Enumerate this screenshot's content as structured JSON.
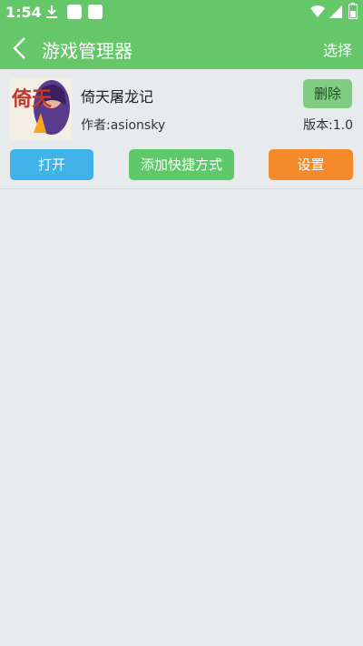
{
  "status_bar": {
    "time": "1:54",
    "icons": [
      "download-icon",
      "notification-square-icon",
      "notification-square-icon",
      "wifi-icon",
      "signal-icon",
      "battery-icon"
    ]
  },
  "app_bar": {
    "title": "游戏管理器",
    "select_label": "选择",
    "background_color": "#66c76a"
  },
  "game_card": {
    "name": "倚天屠龙记",
    "author": "作者:asionsky",
    "version": "版本:1.0",
    "icon_text": "倚天",
    "delete_label": "删除",
    "buttons": {
      "open": "打开",
      "add_shortcut": "添加快捷方式",
      "settings": "设置"
    },
    "colors": {
      "open": "#3fb2e8",
      "add_shortcut": "#5ec96a",
      "settings": "#f58a2a",
      "delete": "#7fcc82"
    }
  }
}
